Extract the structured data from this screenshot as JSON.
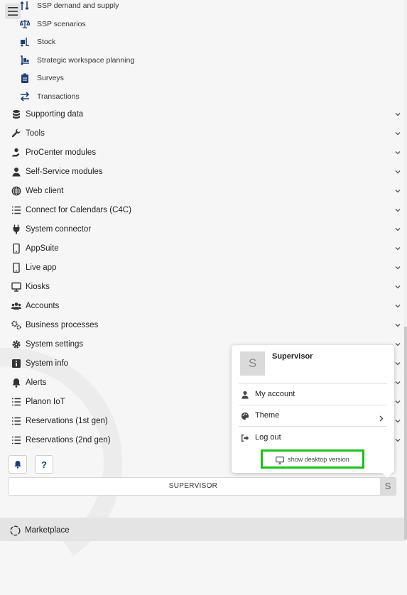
{
  "sub_items": [
    {
      "label": "SSP demand and supply",
      "icon": "sort-arrows-icon"
    },
    {
      "label": "SSP scenarios",
      "icon": "balance-scale-icon"
    },
    {
      "label": "Stock",
      "icon": "forklift-icon"
    },
    {
      "label": "Strategic workspace planning",
      "icon": "dolly-icon"
    },
    {
      "label": "Surveys",
      "icon": "clipboard-icon"
    },
    {
      "label": "Transactions",
      "icon": "exchange-icon"
    }
  ],
  "nav_items": [
    {
      "label": "Supporting data",
      "icon": "database-icon"
    },
    {
      "label": "Tools",
      "icon": "wrench-icon"
    },
    {
      "label": "ProCenter modules",
      "icon": "user-hand-icon"
    },
    {
      "label": "Self-Service modules",
      "icon": "user-icon"
    },
    {
      "label": "Web client",
      "icon": "globe-icon"
    },
    {
      "label": "Connect for Calendars (C4C)",
      "icon": "list-icon"
    },
    {
      "label": "System connector",
      "icon": "plug-icon"
    },
    {
      "label": "AppSuite",
      "icon": "mobile-icon"
    },
    {
      "label": "Live app",
      "icon": "mobile-icon"
    },
    {
      "label": "Kiosks",
      "icon": "desktop-icon"
    },
    {
      "label": "Accounts",
      "icon": "users-icon"
    },
    {
      "label": "Business processes",
      "icon": "cogs-icon"
    },
    {
      "label": "System settings",
      "icon": "gear-icon"
    },
    {
      "label": "System info",
      "icon": "info-icon"
    },
    {
      "label": "Alerts",
      "icon": "bell-icon"
    },
    {
      "label": "Planon IoT",
      "icon": "list-icon"
    },
    {
      "label": "Reservations (1st gen)",
      "icon": "list-icon"
    },
    {
      "label": "Reservations (2nd gen)",
      "icon": "list-icon"
    }
  ],
  "help_label": "?",
  "user_bar": {
    "name": "SUPERVISOR",
    "initial": "S"
  },
  "footer": {
    "label": "Marketplace"
  },
  "popup": {
    "initial": "S",
    "name": "Supervisor",
    "my_account": "My account",
    "theme": "Theme",
    "log_out": "Log out",
    "desktop_version": "show desktop version"
  },
  "colors": {
    "accent": "#1f3f7a",
    "highlight": "#19c119"
  }
}
